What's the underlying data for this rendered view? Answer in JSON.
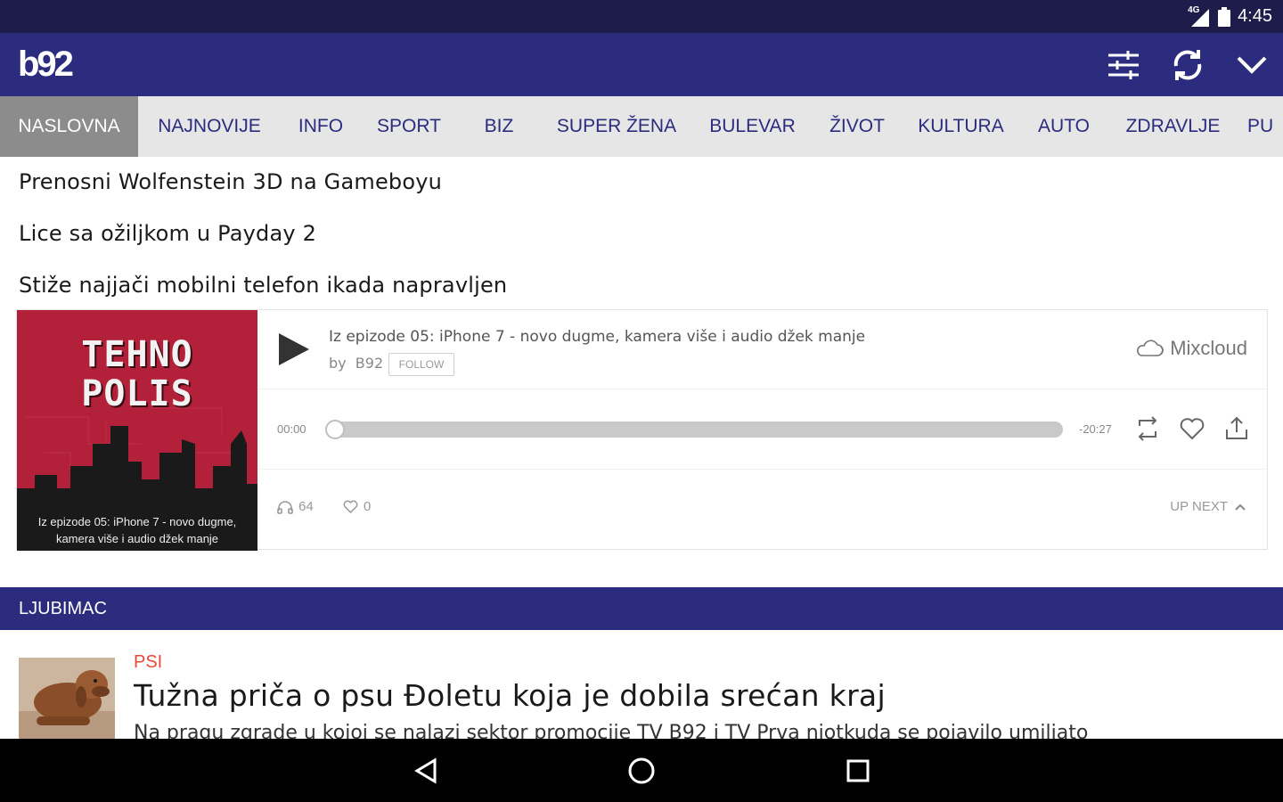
{
  "status_bar": {
    "network": "4G",
    "time": "4:45"
  },
  "app_bar": {
    "logo": "b92",
    "actions": [
      "filter-icon",
      "refresh-icon",
      "chevron-down-icon"
    ]
  },
  "tabs": [
    {
      "label": "NASLOVNA",
      "active": true
    },
    {
      "label": "NAJNOVIJE",
      "active": false
    },
    {
      "label": "INFO",
      "active": false
    },
    {
      "label": "SPORT",
      "active": false
    },
    {
      "label": "BIZ",
      "active": false
    },
    {
      "label": "SUPER ŽENA",
      "active": false
    },
    {
      "label": "BULEVAR",
      "active": false
    },
    {
      "label": "ŽIVOT",
      "active": false
    },
    {
      "label": "KULTURA",
      "active": false
    },
    {
      "label": "AUTO",
      "active": false
    },
    {
      "label": "ZDRAVLJE",
      "active": false
    },
    {
      "label": "PU",
      "active": false
    }
  ],
  "links": [
    "Prenosni Wolfenstein 3D na Gameboyu",
    "Lice sa ožiljkom u Payday 2",
    "Stiže najjači mobilni telefon ikada napravljen"
  ],
  "player": {
    "cover_title_line1": "TEHNO",
    "cover_title_line2": "POLIS",
    "cover_caption_line1": "Iz epizode 05: iPhone 7 - novo dugme,",
    "cover_caption_line2": "kamera više i audio džek manje",
    "episode_title": "Iz epizode 05: iPhone 7 - novo dugme, kamera više i audio džek manje",
    "by_label": "by",
    "author": "B92",
    "follow_label": "FOLLOW",
    "brand": "Mixcloud",
    "time_elapsed": "00:00",
    "time_remaining": "-20:27",
    "progress_fraction": 0.0,
    "plays": "64",
    "favorites": "0",
    "up_next_label": "UP NEXT"
  },
  "section": {
    "title": "LJUBIMAC"
  },
  "article": {
    "category": "PSI",
    "title": "Tužna priča o psu Đoletu koja je dobila srećan kraj",
    "excerpt": "Na pragu zgrade u kojoj se nalazi sektor promocije TV B92 i TV Prva niotkuda se pojavilo umiljato"
  },
  "nav_bar": [
    "back-icon",
    "home-icon",
    "recents-icon"
  ],
  "colors": {
    "status_bar": "#1d1c4a",
    "brand": "#2c2c7f",
    "tab_bg": "#e6e6e6",
    "tab_active": "#8c8c8c",
    "category": "#e84a3a",
    "cover": "#b3203a"
  }
}
